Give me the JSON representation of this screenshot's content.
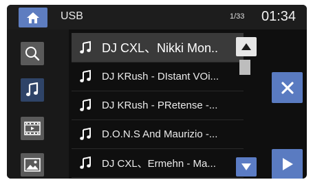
{
  "header": {
    "source": "USB",
    "track_count": "1/33",
    "clock": "01:34"
  },
  "sidebar": {
    "items": [
      {
        "name": "search",
        "icon": "search-icon"
      },
      {
        "name": "music",
        "icon": "music-note-icon",
        "active": true
      },
      {
        "name": "video",
        "icon": "film-icon"
      },
      {
        "name": "photo",
        "icon": "image-icon"
      }
    ]
  },
  "tracks": [
    {
      "title": "DJ CXL、Nikki Mon..",
      "selected": true
    },
    {
      "title": "DJ KRush - DIstant VOi..."
    },
    {
      "title": "DJ KRush - PRetense -..."
    },
    {
      "title": "D.O.N.S And Maurizio -..."
    },
    {
      "title": "DJ CXL、Ermehn - Ma..."
    }
  ],
  "scroll": {
    "position": 0.0
  },
  "colors": {
    "accent": "#5a7bc1",
    "active_side": "#2f4468",
    "background": "#0f0f0f"
  }
}
